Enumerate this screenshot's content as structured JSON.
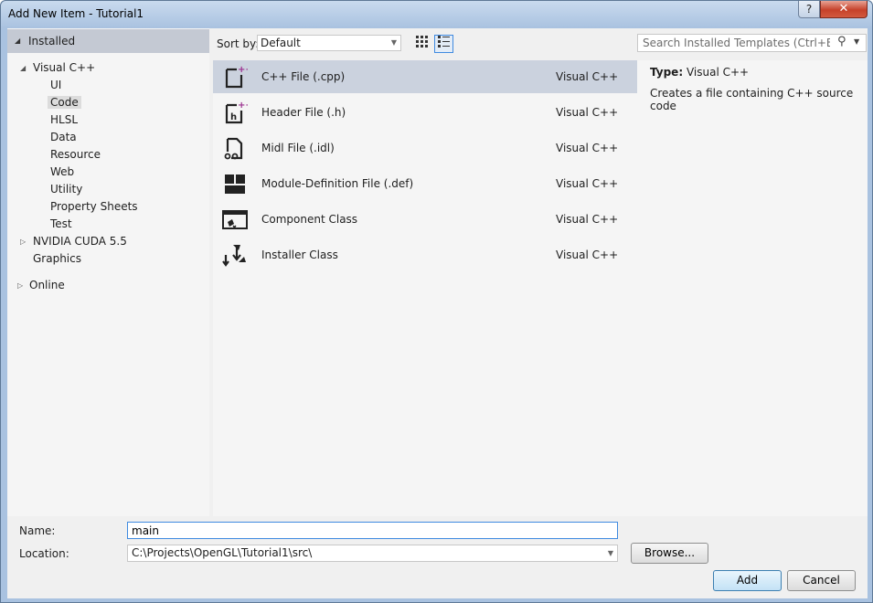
{
  "window": {
    "title": "Add New Item - Tutorial1",
    "help_label": "?",
    "close_label": "✕"
  },
  "tree": {
    "installed_label": "Installed",
    "items": [
      {
        "label": "Visual C++",
        "expander": "◢"
      },
      {
        "label": "UI"
      },
      {
        "label": "Code",
        "selected": true
      },
      {
        "label": "HLSL"
      },
      {
        "label": "Data"
      },
      {
        "label": "Resource"
      },
      {
        "label": "Web"
      },
      {
        "label": "Utility"
      },
      {
        "label": "Property Sheets"
      },
      {
        "label": "Test"
      },
      {
        "label": "NVIDIA CUDA 5.5",
        "expander": "▷"
      },
      {
        "label": "Graphics"
      },
      {
        "label": "Online",
        "expander": "▷"
      }
    ]
  },
  "sort": {
    "label": "Sort by:",
    "value": "Default"
  },
  "view": {
    "small_icons": "small-icons-view",
    "list": "list-view"
  },
  "search": {
    "placeholder": "Search Installed Templates (Ctrl+E)"
  },
  "templates": [
    {
      "name": "C++ File (.cpp)",
      "lang": "Visual C++",
      "icon": "cpp-file-icon",
      "selected": true
    },
    {
      "name": "Header File (.h)",
      "lang": "Visual C++",
      "icon": "header-file-icon"
    },
    {
      "name": "Midl File (.idl)",
      "lang": "Visual C++",
      "icon": "midl-file-icon"
    },
    {
      "name": "Module-Definition File (.def)",
      "lang": "Visual C++",
      "icon": "module-definition-icon"
    },
    {
      "name": "Component Class",
      "lang": "Visual C++",
      "icon": "component-class-icon"
    },
    {
      "name": "Installer Class",
      "lang": "Visual C++",
      "icon": "installer-class-icon"
    }
  ],
  "details": {
    "type_label": "Type:",
    "type_value": "Visual C++",
    "description": "Creates a file containing C++ source code"
  },
  "form": {
    "name_label": "Name:",
    "name_value": "main",
    "location_label": "Location:",
    "location_value": "C:\\Projects\\OpenGL\\Tutorial1\\src\\",
    "browse_label": "Browse...",
    "add_label": "Add",
    "cancel_label": "Cancel"
  }
}
